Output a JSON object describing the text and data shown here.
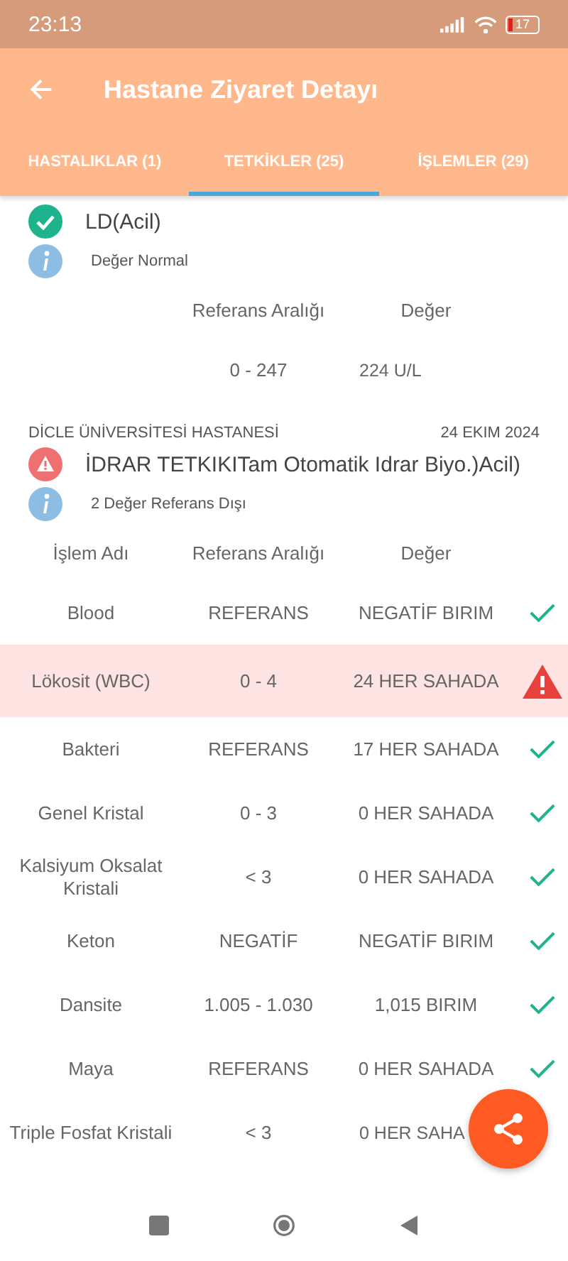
{
  "status_bar": {
    "time": "23:13",
    "battery": "17"
  },
  "app_bar": {
    "title": "Hastane Ziyaret Detayı"
  },
  "tabs": [
    {
      "label": "HASTALIKLAR (1)",
      "selected": false
    },
    {
      "label": "TETKİKLER (25)",
      "selected": true
    },
    {
      "label": "İŞLEMLER (29)",
      "selected": false
    }
  ],
  "tests": [
    {
      "out_of_range": false,
      "title": "LD(Acil)",
      "summary": "Değer Normal",
      "columns": [
        "Referans Aralığı",
        "Değer"
      ],
      "rows": [
        {
          "reference": "0 - 247",
          "value": "224 U/L"
        }
      ]
    },
    {
      "hospital": "DİCLE ÜNİVERSİTESİ HASTANESİ",
      "date": "24 EKIM 2024",
      "out_of_range": true,
      "title": "İDRAR TETKIKITam Otomatik Idrar Biyo.)Acil)",
      "summary": "2 Değer Referans Dışı",
      "columns": [
        "İşlem Adı",
        "Referans Aralığı",
        "Değer"
      ],
      "rows": [
        {
          "name": "Blood",
          "reference": "REFERANS",
          "value": "NEGATİF BIRIM",
          "out_of_range": false
        },
        {
          "name": "Lökosit (WBC)",
          "reference": "0 - 4",
          "value": "24 HER SAHADA",
          "out_of_range": true
        },
        {
          "name": "Bakteri",
          "reference": "REFERANS",
          "value": "17 HER SAHADA",
          "out_of_range": false
        },
        {
          "name": "Genel Kristal",
          "reference": "0 - 3",
          "value": "0 HER SAHADA",
          "out_of_range": false
        },
        {
          "name": "Kalsiyum Oksalat Kristali",
          "reference": "< 3",
          "value": "0 HER SAHADA",
          "out_of_range": false
        },
        {
          "name": "Keton",
          "reference": "NEGATİF",
          "value": "NEGATİF BIRIM",
          "out_of_range": false
        },
        {
          "name": "Dansite",
          "reference": "1.005 - 1.030",
          "value": "1,015 BIRIM",
          "out_of_range": false
        },
        {
          "name": "Maya",
          "reference": "REFERANS",
          "value": "0 HER SAHADA",
          "out_of_range": false
        },
        {
          "name": "Triple Fosfat Kristali",
          "reference": "< 3",
          "value": "0 HER SAHA"
        }
      ]
    }
  ]
}
